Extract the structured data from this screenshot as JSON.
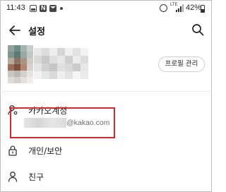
{
  "status_bar": {
    "time": "11:43",
    "network": "LTE",
    "battery_percent": "42%",
    "battery_level": 0.42
  },
  "header": {
    "title": "설정"
  },
  "profile": {
    "manage_button_label": "프로필 관리"
  },
  "menu": {
    "kakao_account": {
      "label": "카카오계정",
      "email_domain": "@kakao.com"
    },
    "privacy": {
      "label": "개인/보안"
    },
    "friends": {
      "label": "친구"
    }
  },
  "colors": {
    "highlight": "#d8262b",
    "text": "#1a1a1a",
    "secondary_text": "#6b6b6b"
  }
}
